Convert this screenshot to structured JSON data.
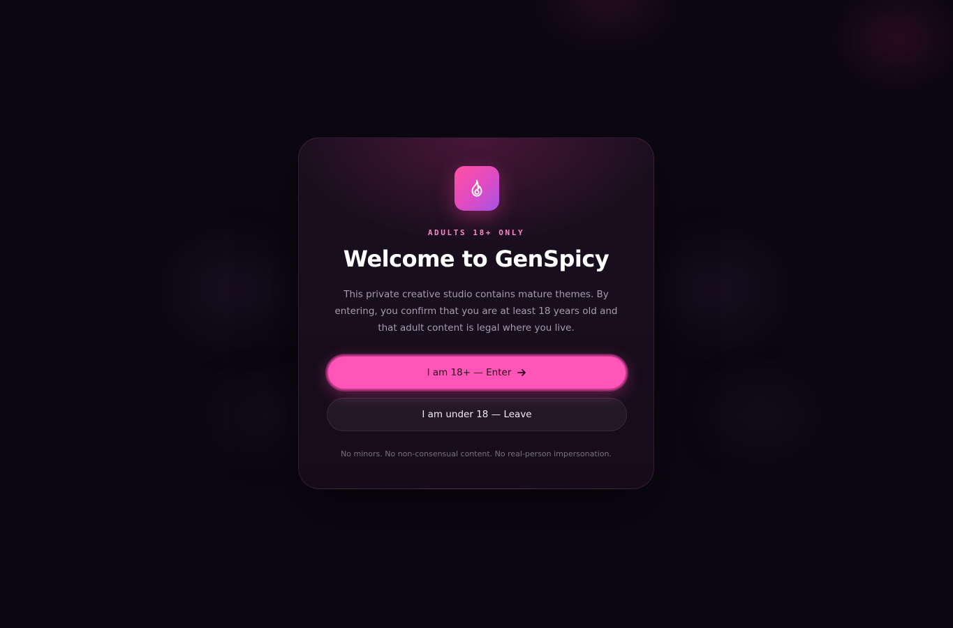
{
  "gate": {
    "logo_icon": "flame-icon",
    "eyebrow": "ADULTS 18+ ONLY",
    "title": "Welcome to GenSpicy",
    "description": "This private creative studio contains mature themes. By entering, you confirm that you are at least 18 years old and that adult content is legal where you live.",
    "enter_label": "I am 18+ — Enter",
    "enter_icon": "arrow-right-icon",
    "leave_label": "I am under 18 — Leave",
    "footnote": "No minors. No non-consensual content. No real-person impersonation."
  },
  "colors": {
    "accent": "#ff55b8",
    "background": "#0c0812",
    "modal": "#1b0f1f"
  }
}
